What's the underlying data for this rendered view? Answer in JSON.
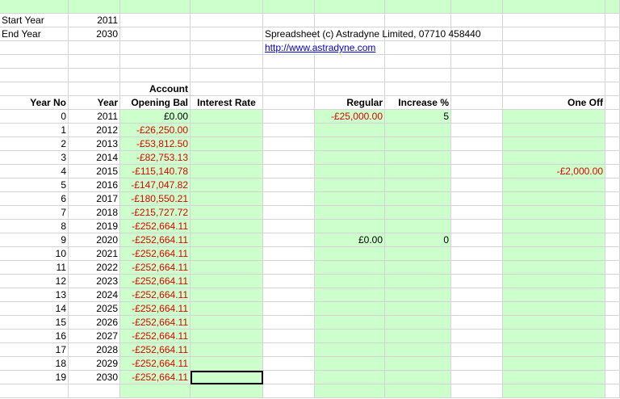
{
  "settings": {
    "start_label": "Start Year",
    "start_value": "2011",
    "end_label": "End Year",
    "end_value": "2030"
  },
  "info": {
    "copyright": "Spreadsheet (c) Astradyne Limited, 07710 458440",
    "url": "http://www.astradyne.com"
  },
  "headers": {
    "account_top": "Account",
    "year_no": "Year No",
    "year": "Year",
    "opening_bal": "Opening Bal",
    "interest_rate": "Interest Rate",
    "regular": "Regular",
    "increase": "Increase %",
    "one_off": "One Off"
  },
  "colors": {
    "green_fill": "#ccffcc",
    "negative": "#e00000",
    "link": "#0000cc"
  },
  "rows": [
    {
      "year_no": "0",
      "year": "2011",
      "balance": "£0.00",
      "regular": "-£25,000.00",
      "increase": "5",
      "one_off": ""
    },
    {
      "year_no": "1",
      "year": "2012",
      "balance": "-£26,250.00",
      "regular": "",
      "increase": "",
      "one_off": ""
    },
    {
      "year_no": "2",
      "year": "2013",
      "balance": "-£53,812.50",
      "regular": "",
      "increase": "",
      "one_off": ""
    },
    {
      "year_no": "3",
      "year": "2014",
      "balance": "-£82,753.13",
      "regular": "",
      "increase": "",
      "one_off": ""
    },
    {
      "year_no": "4",
      "year": "2015",
      "balance": "-£115,140.78",
      "regular": "",
      "increase": "",
      "one_off": "-£2,000.00"
    },
    {
      "year_no": "5",
      "year": "2016",
      "balance": "-£147,047.82",
      "regular": "",
      "increase": "",
      "one_off": ""
    },
    {
      "year_no": "6",
      "year": "2017",
      "balance": "-£180,550.21",
      "regular": "",
      "increase": "",
      "one_off": ""
    },
    {
      "year_no": "7",
      "year": "2018",
      "balance": "-£215,727.72",
      "regular": "",
      "increase": "",
      "one_off": ""
    },
    {
      "year_no": "8",
      "year": "2019",
      "balance": "-£252,664.11",
      "regular": "",
      "increase": "",
      "one_off": ""
    },
    {
      "year_no": "9",
      "year": "2020",
      "balance": "-£252,664.11",
      "regular": "£0.00",
      "increase": "0",
      "one_off": ""
    },
    {
      "year_no": "10",
      "year": "2021",
      "balance": "-£252,664.11",
      "regular": "",
      "increase": "",
      "one_off": ""
    },
    {
      "year_no": "11",
      "year": "2022",
      "balance": "-£252,664.11",
      "regular": "",
      "increase": "",
      "one_off": ""
    },
    {
      "year_no": "12",
      "year": "2023",
      "balance": "-£252,664.11",
      "regular": "",
      "increase": "",
      "one_off": ""
    },
    {
      "year_no": "13",
      "year": "2024",
      "balance": "-£252,664.11",
      "regular": "",
      "increase": "",
      "one_off": ""
    },
    {
      "year_no": "14",
      "year": "2025",
      "balance": "-£252,664.11",
      "regular": "",
      "increase": "",
      "one_off": ""
    },
    {
      "year_no": "15",
      "year": "2026",
      "balance": "-£252,664.11",
      "regular": "",
      "increase": "",
      "one_off": ""
    },
    {
      "year_no": "16",
      "year": "2027",
      "balance": "-£252,664.11",
      "regular": "",
      "increase": "",
      "one_off": ""
    },
    {
      "year_no": "17",
      "year": "2028",
      "balance": "-£252,664.11",
      "regular": "",
      "increase": "",
      "one_off": ""
    },
    {
      "year_no": "18",
      "year": "2029",
      "balance": "-£252,664.11",
      "regular": "",
      "increase": "",
      "one_off": ""
    },
    {
      "year_no": "19",
      "year": "2030",
      "balance": "-£252,664.11",
      "regular": "",
      "increase": "",
      "one_off": ""
    }
  ]
}
